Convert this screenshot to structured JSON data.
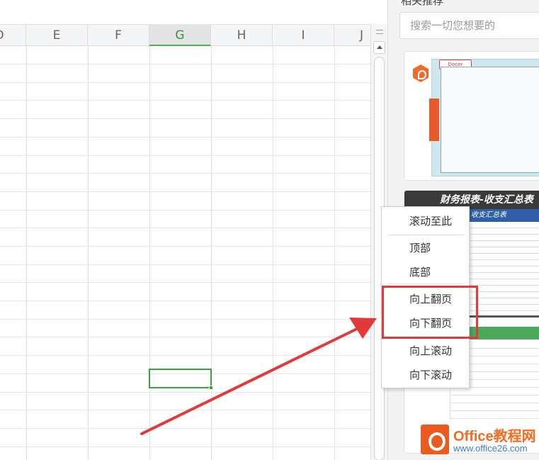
{
  "sheet": {
    "columns": [
      "D",
      "E",
      "F",
      "G",
      "H",
      "I",
      "J"
    ],
    "active_column": "G",
    "selection_color": "#3f9f3f"
  },
  "panel": {
    "title": "相关推荐",
    "search": {
      "placeholder": "搜索一切您想要的"
    },
    "cards": [
      {
        "name": "template-card-1",
        "logo_text": "Docer"
      },
      {
        "name": "template-card-2",
        "banner": "财务报表-收支汇总表",
        "sub_banner": "收支汇总表"
      }
    ]
  },
  "context_menu": {
    "items": [
      "滚动至此",
      "顶部",
      "底部",
      "向上翻页",
      "向下翻页",
      "向上滚动",
      "向下滚动"
    ],
    "highlighted": [
      "向上翻页",
      "向下翻页"
    ],
    "highlight_color": "#e23a3a"
  },
  "watermark": {
    "title": "Office教程网",
    "url": "www.office26.com"
  },
  "colors": {
    "accent_green": "#3f9f3f",
    "annotation_red": "#e23a3a",
    "brand_orange": "#eb5b20"
  }
}
